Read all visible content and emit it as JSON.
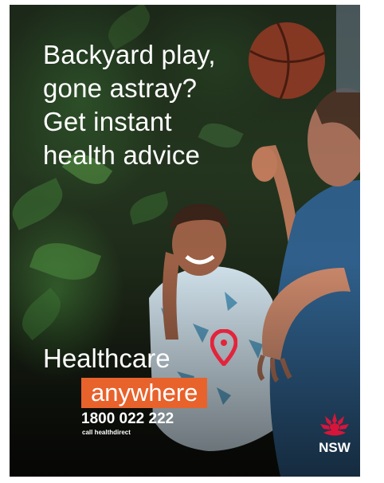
{
  "poster": {
    "headline": [
      "Backyard play,",
      "gone astray?",
      "Get instant",
      "health advice"
    ],
    "brand_line1": "Healthcare",
    "brand_line2": "anywhere",
    "phone": "1800 022 222",
    "phone_caption": "call healthdirect",
    "logo_text": "NSW",
    "accent_color": "#e8622c",
    "pin_color": "#e3243b",
    "logo_color": "#d7153a",
    "icons": [
      "location-pin-icon",
      "waratah-icon"
    ]
  }
}
